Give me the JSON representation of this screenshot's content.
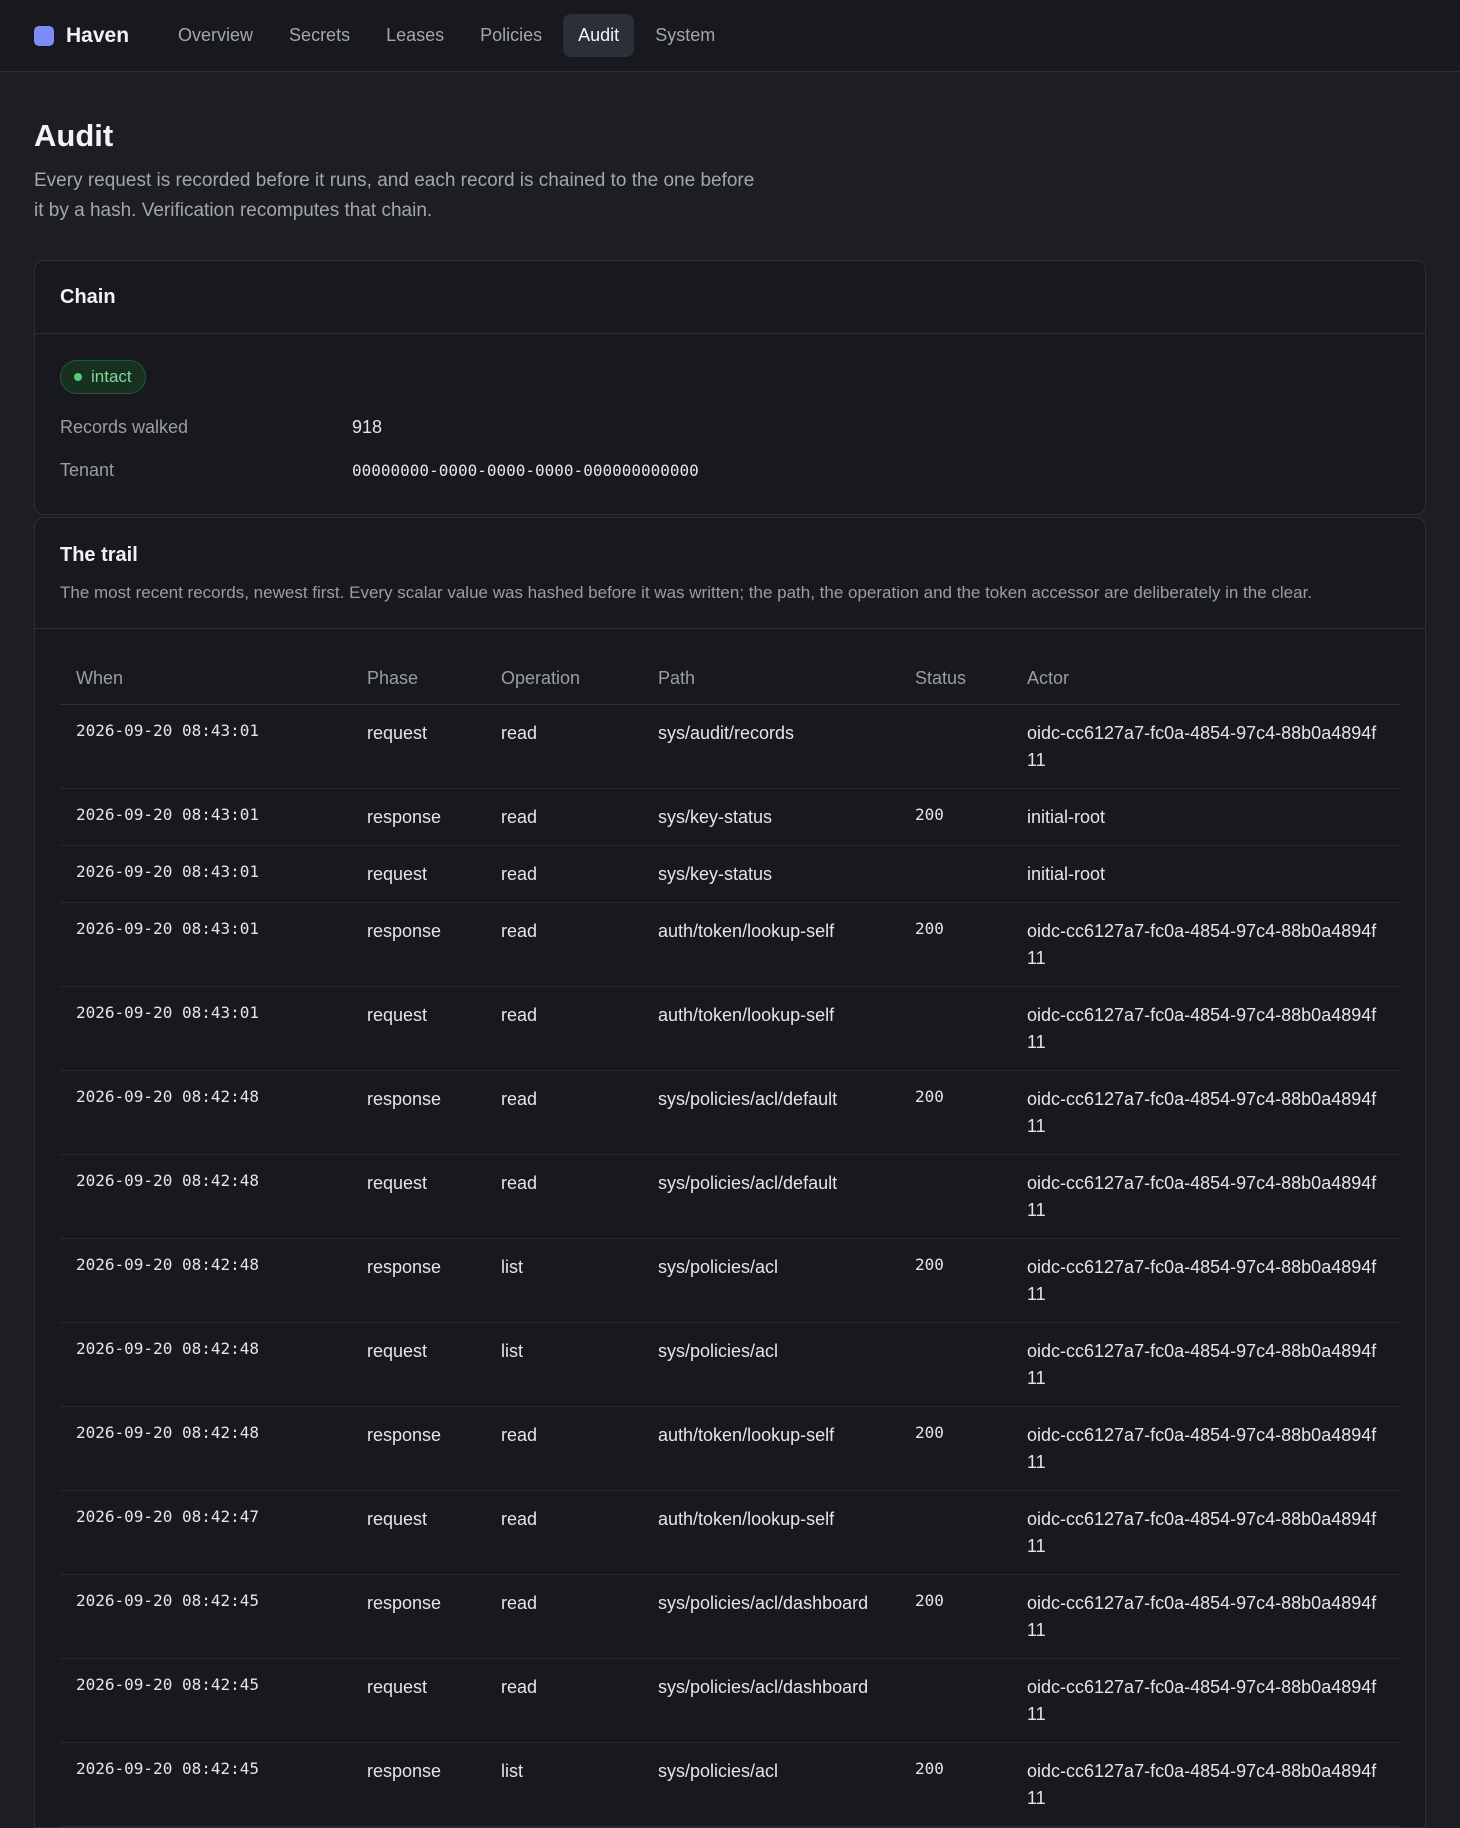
{
  "app": {
    "name": "Haven"
  },
  "nav": [
    {
      "label": "Overview",
      "active": false
    },
    {
      "label": "Secrets",
      "active": false
    },
    {
      "label": "Leases",
      "active": false
    },
    {
      "label": "Policies",
      "active": false
    },
    {
      "label": "Audit",
      "active": true
    },
    {
      "label": "System",
      "active": false
    }
  ],
  "page": {
    "title": "Audit",
    "description": "Every request is recorded before it runs, and each record is chained to the one before it by a hash. Verification recomputes that chain."
  },
  "chain": {
    "title": "Chain",
    "status": "intact",
    "records_walked_label": "Records walked",
    "records_walked": "918",
    "tenant_label": "Tenant",
    "tenant": "00000000-0000-0000-0000-000000000000"
  },
  "trail": {
    "title": "The trail",
    "description": "The most recent records, newest first. Every scalar value was hashed before it was written; the path, the operation and the token accessor are deliberately in the clear.",
    "columns": [
      "When",
      "Phase",
      "Operation",
      "Path",
      "Status",
      "Actor"
    ],
    "rows": [
      [
        "2026-09-20 08:43:01",
        "request",
        "read",
        "sys/audit/records",
        "",
        "oidc-cc6127a7-fc0a-4854-97c4-88b0a4894f11"
      ],
      [
        "2026-09-20 08:43:01",
        "response",
        "read",
        "sys/key-status",
        "200",
        "initial-root"
      ],
      [
        "2026-09-20 08:43:01",
        "request",
        "read",
        "sys/key-status",
        "",
        "initial-root"
      ],
      [
        "2026-09-20 08:43:01",
        "response",
        "read",
        "auth/token/lookup-self",
        "200",
        "oidc-cc6127a7-fc0a-4854-97c4-88b0a4894f11"
      ],
      [
        "2026-09-20 08:43:01",
        "request",
        "read",
        "auth/token/lookup-self",
        "",
        "oidc-cc6127a7-fc0a-4854-97c4-88b0a4894f11"
      ],
      [
        "2026-09-20 08:42:48",
        "response",
        "read",
        "sys/policies/acl/default",
        "200",
        "oidc-cc6127a7-fc0a-4854-97c4-88b0a4894f11"
      ],
      [
        "2026-09-20 08:42:48",
        "request",
        "read",
        "sys/policies/acl/default",
        "",
        "oidc-cc6127a7-fc0a-4854-97c4-88b0a4894f11"
      ],
      [
        "2026-09-20 08:42:48",
        "response",
        "list",
        "sys/policies/acl",
        "200",
        "oidc-cc6127a7-fc0a-4854-97c4-88b0a4894f11"
      ],
      [
        "2026-09-20 08:42:48",
        "request",
        "list",
        "sys/policies/acl",
        "",
        "oidc-cc6127a7-fc0a-4854-97c4-88b0a4894f11"
      ],
      [
        "2026-09-20 08:42:48",
        "response",
        "read",
        "auth/token/lookup-self",
        "200",
        "oidc-cc6127a7-fc0a-4854-97c4-88b0a4894f11"
      ],
      [
        "2026-09-20 08:42:47",
        "request",
        "read",
        "auth/token/lookup-self",
        "",
        "oidc-cc6127a7-fc0a-4854-97c4-88b0a4894f11"
      ],
      [
        "2026-09-20 08:42:45",
        "response",
        "read",
        "sys/policies/acl/dashboard",
        "200",
        "oidc-cc6127a7-fc0a-4854-97c4-88b0a4894f11"
      ],
      [
        "2026-09-20 08:42:45",
        "request",
        "read",
        "sys/policies/acl/dashboard",
        "",
        "oidc-cc6127a7-fc0a-4854-97c4-88b0a4894f11"
      ],
      [
        "2026-09-20 08:42:45",
        "response",
        "list",
        "sys/policies/acl",
        "200",
        "oidc-cc6127a7-fc0a-4854-97c4-88b0a4894f11"
      ]
    ]
  },
  "colors": {
    "accent": "#7d8cf7",
    "status_ok": "#4fcd7a",
    "background": "#1c1e24"
  }
}
